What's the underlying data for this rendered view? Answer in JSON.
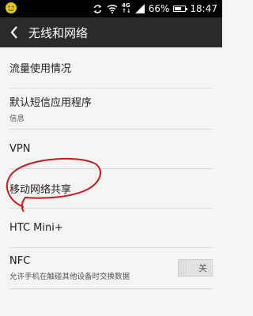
{
  "status_bar": {
    "network": "4G",
    "battery": "66%",
    "battery_level": 0.66,
    "time": "18:47"
  },
  "action_bar": {
    "title": "无线和网络"
  },
  "items": [
    {
      "label": "流量使用情况"
    },
    {
      "label": "默认短信应用程序",
      "sub": "信息"
    },
    {
      "label": "VPN"
    },
    {
      "label": "移动网络共享"
    },
    {
      "label": "HTC Mini+"
    },
    {
      "label": "NFC",
      "sub": "允许手机在触碰其他设备时交换数据",
      "toggle": "关"
    }
  ]
}
